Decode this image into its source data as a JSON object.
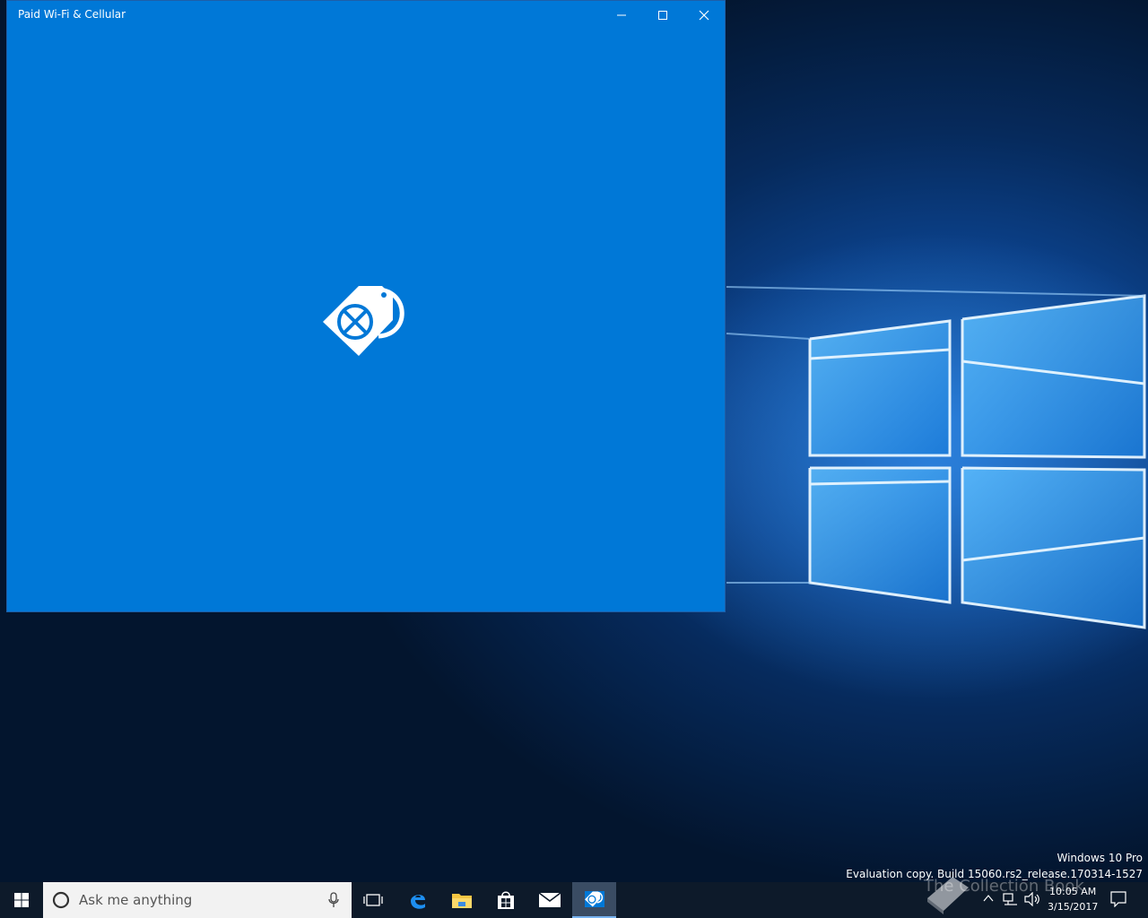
{
  "app_window": {
    "title": "Paid Wi-Fi & Cellular",
    "minimize_icon": "minimize-icon",
    "maximize_icon": "maximize-icon",
    "close_icon": "close-icon",
    "splash_icon": "sim-tag-globe-icon",
    "accent_color": "#0078d7"
  },
  "desktop": {
    "watermark_line1": "Windows 10 Pro",
    "watermark_line2": "Evaluation copy. Build 15060.rs2_release.170314-1527",
    "overlay_brand": "The Collection Book"
  },
  "taskbar": {
    "start_icon": "windows-start-icon",
    "search_placeholder": "Ask me anything",
    "cortana_icon": "cortana-circle-icon",
    "mic_icon": "microphone-icon",
    "apps": [
      {
        "name": "task-view",
        "icon": "task-view-icon"
      },
      {
        "name": "edge",
        "icon": "edge-icon"
      },
      {
        "name": "file-explorer",
        "icon": "folder-icon"
      },
      {
        "name": "store",
        "icon": "store-icon"
      },
      {
        "name": "mail",
        "icon": "mail-icon"
      },
      {
        "name": "paid-wifi-cellular",
        "icon": "sim-tag-globe-icon",
        "active": true
      }
    ],
    "tray": {
      "time": "10:05 AM",
      "date": "3/15/2017",
      "chevron_icon": "chevron-up-icon",
      "network_icon": "network-icon",
      "volume_icon": "volume-icon",
      "notification_icon": "action-center-icon"
    }
  }
}
